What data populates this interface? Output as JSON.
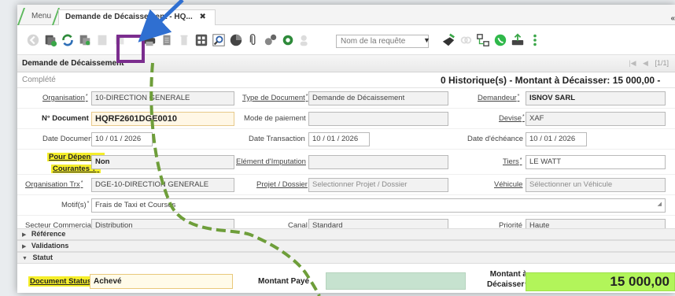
{
  "tabs": {
    "menu_label": "Menu",
    "active_label": "Demande de Décaissement - HQ...",
    "close_glyph": "✖",
    "right_glyph": "«"
  },
  "toolbar": {
    "query_placeholder": "Nom de la requête",
    "query_arrow": "▼"
  },
  "header": {
    "title": "Demande de Décaissement",
    "pager_text": "[1/1]",
    "pager_first": "|◀",
    "pager_prev": "◀"
  },
  "status": {
    "state": "Complété",
    "summary": "0 Historique(s) - Montant à Décaisser: 15 000,00 -"
  },
  "form": {
    "organisation_label": "Organisation",
    "organisation_value": "10-DIRECTION GENERALE",
    "type_doc_label": "Type de Document",
    "type_doc_value": "Demande de Décaissement",
    "demandeur_label": "Demandeur",
    "demandeur_value": "ISNOV SARL",
    "n_doc_label": "N° Document",
    "n_doc_value": "HQRF2601DGE0010",
    "mode_paiement_label": "Mode de paiement",
    "mode_paiement_value": "",
    "devise_label": "Devise",
    "devise_value": "XAF",
    "date_doc_label": "Date Document",
    "date_doc_value": "10 / 01 / 2026",
    "date_trans_label": "Date Transaction",
    "date_trans_value": "10 / 01 / 2026",
    "date_echeance_label": "Date d'échéance",
    "date_echeance_value": "10 / 01 / 2026",
    "depenses_label_1": "Pour Dépenses",
    "depenses_label_2": "Courantes ?",
    "depenses_value": "Non",
    "element_imputation_label": "Elément d'Imputation",
    "element_imputation_value": "",
    "tiers_label": "Tiers",
    "tiers_value": "LE WATT",
    "org_trx_label": "Organisation Trx",
    "org_trx_value": "DGE-10-DIRECTION GENERALE",
    "projet_label": "Projet / Dossier",
    "projet_placeholder": "Selectionner Projet / Dossier",
    "vehicule_label": "Véhicule",
    "vehicule_placeholder": "Sélectionner un Véhicule",
    "motif_label": "Motif(s)",
    "motif_value": "Frais de Taxi et Courses",
    "resize_glyph": "◢",
    "secteur_label": "Secteur Commercial",
    "secteur_value": "Distribution",
    "canal_label": "Canal",
    "canal_value": "Standard",
    "priorite_label": "Priorité",
    "priorite_value": "Haute"
  },
  "sections": {
    "reference": "Référence",
    "validations": "Validations",
    "statut": "Statut",
    "collapsed_glyph": "▶",
    "expanded_glyph": "▼"
  },
  "bottom": {
    "doc_status_label": "Document Status",
    "doc_status_value": "Achevé",
    "montant_paye_label": "Montant Payé",
    "montant_decaisser_label_1": "Montant à",
    "montant_decaisser_label_2": "Décaisser",
    "montant_decaisser_value": "15 000,00"
  },
  "colors": {
    "highlight_box": "#7b2d8e",
    "arrow_blue": "#2f6fd1",
    "dash_green": "#6e9e3a",
    "status_yellow": "#f5ee2a",
    "amount_green": "#b2f55a",
    "paid_green": "#c6e2cf"
  }
}
